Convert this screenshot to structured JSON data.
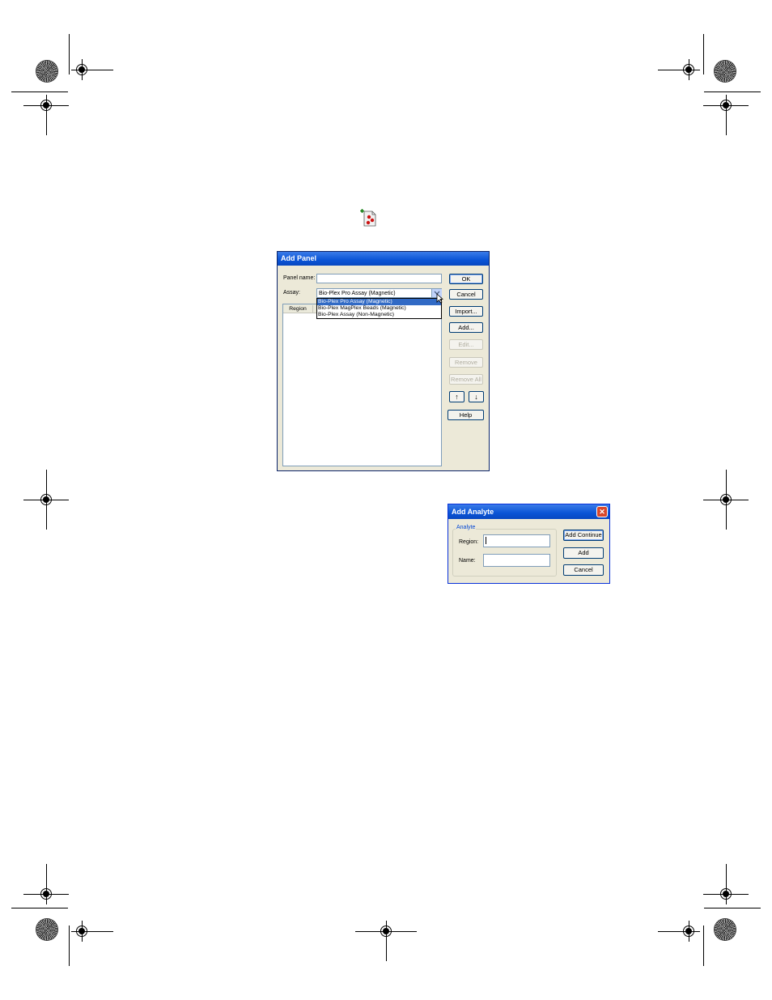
{
  "toolbar_icon": {
    "name": "add-panel-icon",
    "colors": [
      "#cc1111",
      "#dddddd",
      "#2a8a2a"
    ]
  },
  "add_panel": {
    "title": "Add Panel",
    "panel_name_label": "Panel name:",
    "panel_name_value": "",
    "assay_label": "Assay:",
    "assay_selected": "Bio-Plex Pro Assay (Magnetic)",
    "assay_options": [
      "Bio-Plex Pro Assay (Magnetic)",
      "Bio-Plex MagPlex Beads (Magnetic)",
      "Bio-Plex Assay (Non-Magnetic)"
    ],
    "column_region": "Region",
    "buttons": {
      "ok": "OK",
      "cancel": "Cancel",
      "import": "Import...",
      "add": "Add...",
      "edit": "Edit...",
      "remove": "Remove",
      "remove_all": "Remove All",
      "move_up": "↑",
      "move_down": "↓",
      "help": "Help"
    }
  },
  "add_analyte": {
    "title": "Add Analyte",
    "group_label": "Analyte",
    "region_label": "Region:",
    "region_value": "",
    "name_label": "Name:",
    "name_value": "",
    "buttons": {
      "add_continue": "Add Continue",
      "add": "Add",
      "cancel": "Cancel",
      "close": "✕"
    }
  }
}
